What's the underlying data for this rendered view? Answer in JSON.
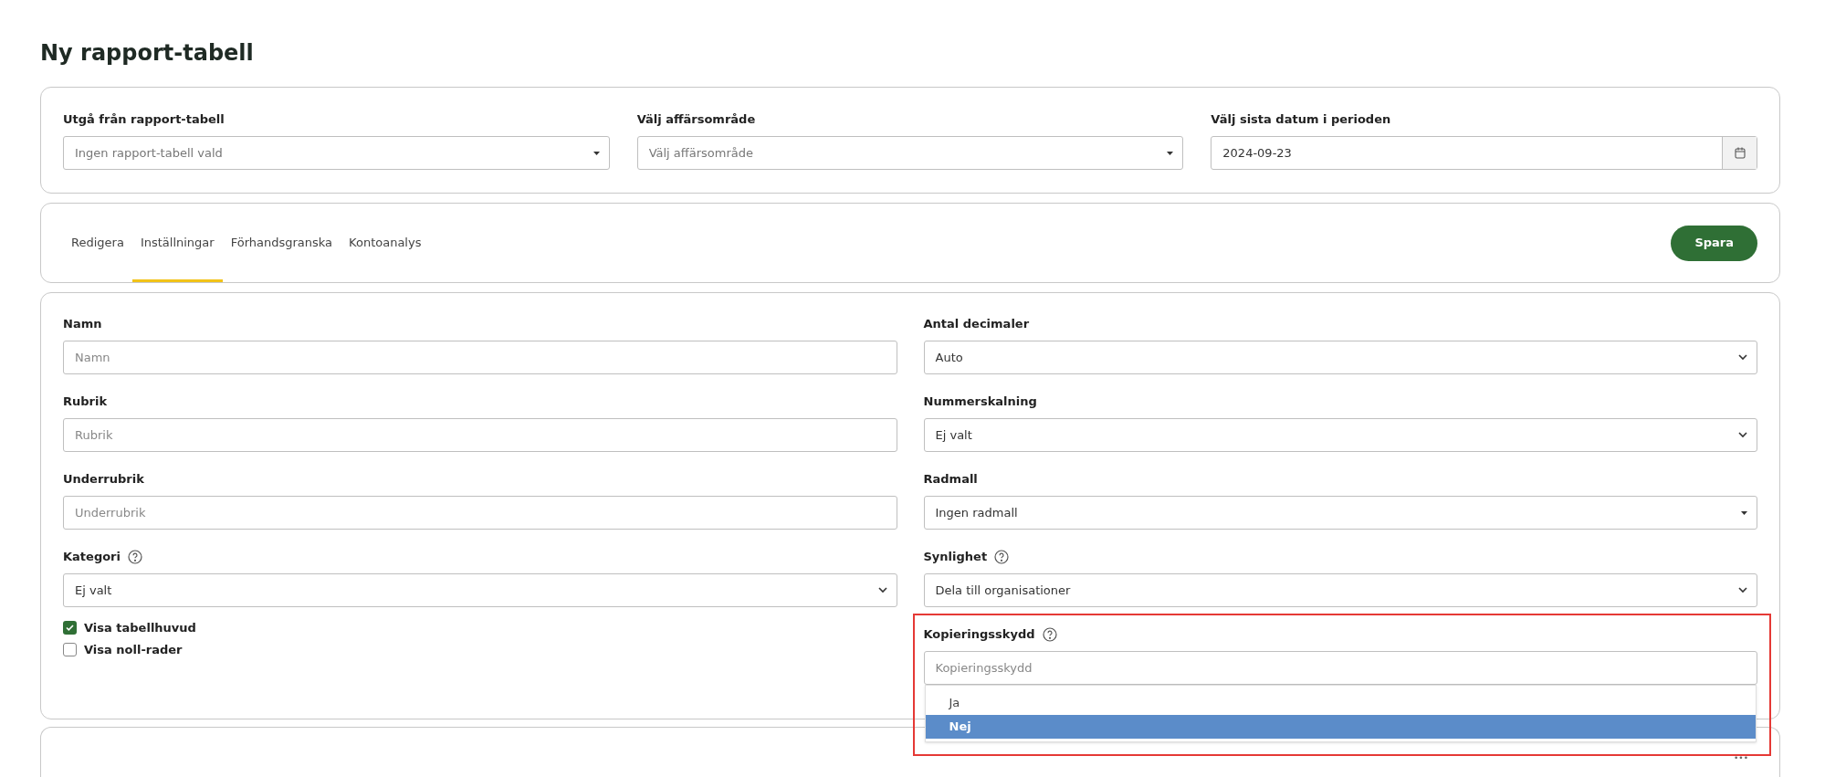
{
  "title": "Ny rapport-tabell",
  "top_fields": [
    {
      "label": "Utgå från rapport-tabell",
      "kind": "combo",
      "placeholder": "Ingen rapport-tabell vald"
    },
    {
      "label": "Välj affärsområde",
      "kind": "combo",
      "placeholder": "Välj affärsområde"
    },
    {
      "label": "Välj sista datum i perioden",
      "kind": "date",
      "value": "2024-09-23"
    }
  ],
  "tabs": [
    {
      "label": "Redigera",
      "selected": false
    },
    {
      "label": "Inställningar",
      "selected": true
    },
    {
      "label": "Förhandsgranska",
      "selected": false
    },
    {
      "label": "Kontoanalys",
      "selected": false
    }
  ],
  "save_button": "Spara",
  "left_fields": [
    {
      "label": "Namn",
      "kind": "text",
      "placeholder": "Namn",
      "help": false
    },
    {
      "label": "Rubrik",
      "kind": "text",
      "placeholder": "Rubrik",
      "help": false
    },
    {
      "label": "Underrubrik",
      "kind": "text",
      "placeholder": "Underrubrik",
      "help": false
    },
    {
      "label": "Kategori",
      "kind": "select",
      "value": "Ej valt",
      "help": true
    }
  ],
  "checkboxes": [
    {
      "label": "Visa tabellhuvud",
      "checked": true
    },
    {
      "label": "Visa noll-rader",
      "checked": false
    }
  ],
  "right_fields": [
    {
      "label": "Antal decimaler",
      "kind": "select",
      "value": "Auto",
      "help": false
    },
    {
      "label": "Nummerskalning",
      "kind": "select",
      "value": "Ej valt",
      "help": false
    },
    {
      "label": "Radmall",
      "kind": "combo",
      "value": "Ingen radmall",
      "help": false
    },
    {
      "label": "Synlighet",
      "kind": "select",
      "value": "Dela till organisationer",
      "help": true
    }
  ],
  "copy_protection": {
    "label": "Kopieringsskydd",
    "help": true,
    "placeholder": "Kopieringsskydd",
    "options": [
      {
        "label": "Ja",
        "selected": false
      },
      {
        "label": "Nej",
        "selected": true
      }
    ]
  },
  "more_button": "•••"
}
